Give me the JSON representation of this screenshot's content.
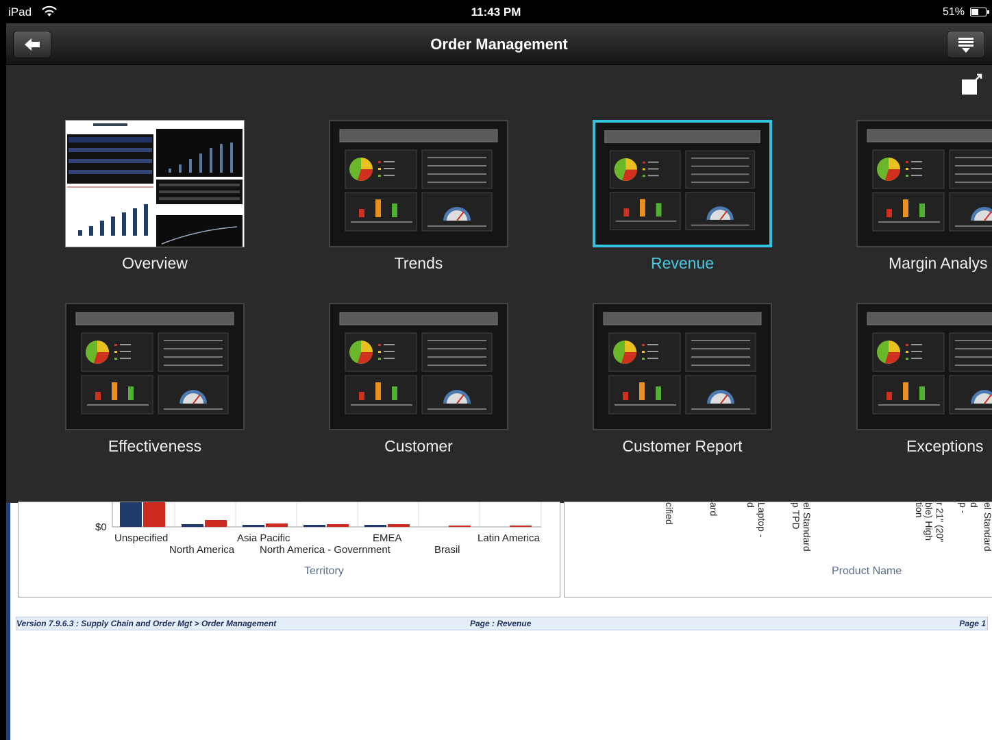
{
  "status_bar": {
    "device": "iPad",
    "time": "11:43 PM",
    "battery": "51%"
  },
  "nav": {
    "title": "Order Management",
    "back_icon": "back-arrow-icon",
    "menu_icon": "page-menu-icon"
  },
  "overlay": {
    "expand_icon": "expand-icon",
    "pages": [
      {
        "label": "Overview"
      },
      {
        "label": "Trends"
      },
      {
        "label": "Revenue",
        "selected": true
      },
      {
        "label": "Margin Analys"
      },
      {
        "label": "Effectiveness"
      },
      {
        "label": "Customer"
      },
      {
        "label": "Customer Report"
      },
      {
        "label": "Exceptions"
      }
    ]
  },
  "report": {
    "left_chart": {
      "y_tick": "$0",
      "categories_row1": [
        "Unspecified",
        "Asia Pacific",
        "EMEA",
        "Latin America"
      ],
      "categories_row2": [
        "North America",
        "North America - Government",
        "Brasil"
      ],
      "axis_title": "Territory"
    },
    "right_chart": {
      "fragments": [
        "cified",
        "ard",
        "d",
        "Laptop -",
        "p TPD",
        "el Standard",
        "ble) High",
        "tion",
        "r 21\" (20\"",
        "p -",
        "d",
        "el Standard"
      ],
      "axis_title": "Product Name"
    },
    "footer": {
      "left": "Version 7.9.6.3 : Supply Chain and Order Mgt > Order Management",
      "center": "Page : Revenue",
      "right": "Page 1"
    }
  },
  "colors": {
    "accent_selected": "#34c1dd",
    "bar_navy": "#1f3a6b",
    "bar_red": "#cc2a1f"
  }
}
